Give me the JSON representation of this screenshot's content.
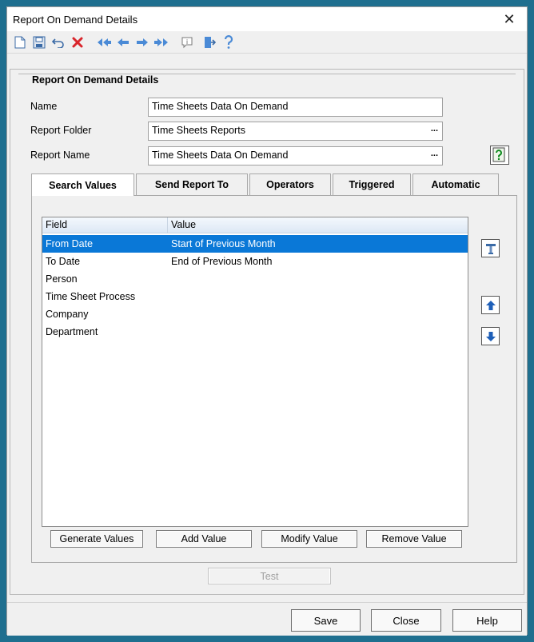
{
  "window": {
    "title": "Report On Demand Details",
    "close_icon": "close-icon"
  },
  "toolbar": {
    "icons": [
      "new-document-icon",
      "save-icon",
      "undo-icon",
      "delete-icon",
      "first-record-icon",
      "previous-record-icon",
      "next-record-icon",
      "last-record-icon",
      "info-icon",
      "exit-icon",
      "help-icon"
    ]
  },
  "group": {
    "title": "Report On Demand Details"
  },
  "form": {
    "name_label": "Name",
    "name_value": "Time Sheets Data On Demand",
    "folder_label": "Report Folder",
    "folder_value": "Time Sheets Reports",
    "report_label": "Report Name",
    "report_value": "Time Sheets Data On Demand",
    "ellipsis": "..."
  },
  "tabs": [
    "Search Values",
    "Send Report To",
    "Operators",
    "Triggered",
    "Automatic"
  ],
  "grid": {
    "columns": [
      "Field",
      "Value"
    ],
    "rows": [
      {
        "field": "From Date",
        "value": "Start of Previous Month",
        "selected": true
      },
      {
        "field": "To Date",
        "value": "End of Previous Month",
        "selected": false
      },
      {
        "field": "Person",
        "value": "",
        "selected": false
      },
      {
        "field": "Time Sheet Process",
        "value": "",
        "selected": false
      },
      {
        "field": "Company",
        "value": "",
        "selected": false
      },
      {
        "field": "Department",
        "value": "",
        "selected": false
      }
    ]
  },
  "grid_buttons": {
    "generate": "Generate Values",
    "add": "Add Value",
    "modify": "Modify Value",
    "remove": "Remove Value"
  },
  "test_button": "Test",
  "footer": {
    "save": "Save",
    "close": "Close",
    "help": "Help"
  },
  "colors": {
    "selection": "#0a78d7",
    "accent_blue": "#1e5fb8",
    "delete_red": "#d9252b",
    "help_green": "#0c8a1c"
  }
}
